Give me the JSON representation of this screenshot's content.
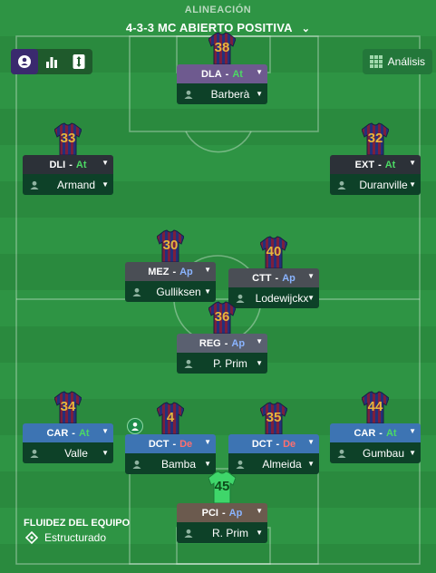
{
  "header": {
    "subtitle": "ALINEACIÓN",
    "title": "4-3-3 MC ABIERTO POSITIVA"
  },
  "analysis_label": "Análisis",
  "fluidity": {
    "label": "FLUIDEZ DEL EQUIPO",
    "value": "Estructurado"
  },
  "colors": {
    "attack": "#4cd964",
    "support": "#8ab4ff",
    "defend": "#ff6f6f"
  },
  "players": [
    {
      "id": "dla",
      "number": "38",
      "role": "DLA",
      "duty": "At",
      "name": "Barberà",
      "role_color": "#6e5a8f"
    },
    {
      "id": "dli",
      "number": "33",
      "role": "DLI",
      "duty": "At",
      "name": "Armand",
      "role_color": "#2c3138"
    },
    {
      "id": "ext",
      "number": "32",
      "role": "EXT",
      "duty": "At",
      "name": "Duranville",
      "role_color": "#2c3138"
    },
    {
      "id": "mez",
      "number": "30",
      "role": "MEZ",
      "duty": "Ap",
      "name": "Gulliksen",
      "role_color": "#4a4e55"
    },
    {
      "id": "ctt",
      "number": "40",
      "role": "CTT",
      "duty": "Ap",
      "name": "Lodewijckx",
      "role_color": "#4a4e55"
    },
    {
      "id": "reg",
      "number": "36",
      "role": "REG",
      "duty": "Ap",
      "name": "P. Prim",
      "role_color": "#5a6070"
    },
    {
      "id": "car-l",
      "number": "34",
      "role": "CAR",
      "duty": "At",
      "name": "Valle",
      "role_color": "#3d74b3"
    },
    {
      "id": "dct-l",
      "number": "4",
      "role": "DCT",
      "duty": "De",
      "name": "Bamba",
      "role_color": "#3d74b3"
    },
    {
      "id": "dct-r",
      "number": "35",
      "role": "DCT",
      "duty": "De",
      "name": "Almeida",
      "role_color": "#3d74b3"
    },
    {
      "id": "car-r",
      "number": "44",
      "role": "CAR",
      "duty": "At",
      "name": "Gumbau",
      "role_color": "#3d74b3"
    },
    {
      "id": "pci",
      "number": "45",
      "role": "PCI",
      "duty": "Ap",
      "name": "R. Prim",
      "role_color": "#6b5a4e",
      "goalkeeper": true
    }
  ]
}
